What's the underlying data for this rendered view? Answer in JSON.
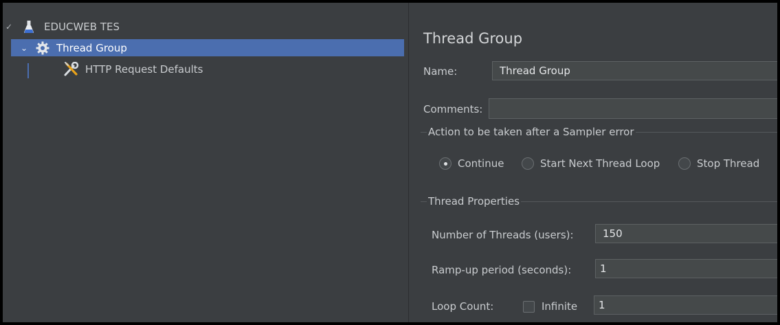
{
  "tree": {
    "root_label": "EDUCWEB TES",
    "thread_group_label": "Thread Group",
    "http_defaults_label": "HTTP Request Defaults"
  },
  "editor": {
    "title": "Thread Group",
    "name_label": "Name:",
    "name_value": "Thread Group",
    "comments_label": "Comments:",
    "comments_value": "",
    "sampler_error_legend": "Action to be taken after a Sampler error",
    "radio_continue": "Continue",
    "radio_start_next": "Start Next Thread Loop",
    "radio_stop_thread": "Stop Thread",
    "selected_action": "Continue",
    "thread_props_legend": "Thread Properties",
    "threads_label": "Number of Threads (users):",
    "threads_value": "150",
    "rampup_label": "Ramp-up period (seconds):",
    "rampup_value": "1",
    "loop_label": "Loop Count:",
    "infinite_label": "Infinite",
    "infinite_checked": false,
    "loop_value": "1"
  },
  "colors": {
    "selection": "#4b6eaf",
    "panel_bg": "#3b3e41",
    "field_bg": "#45494a"
  }
}
